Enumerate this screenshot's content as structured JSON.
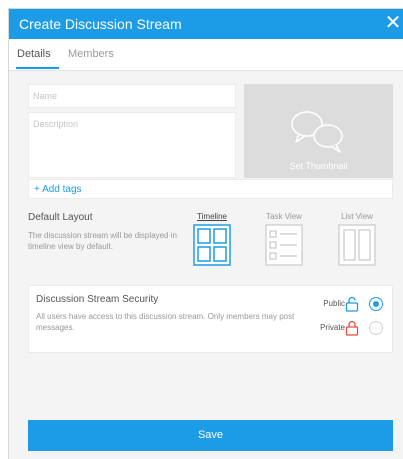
{
  "dialog": {
    "title": "Create Discussion Stream",
    "close_icon": "close-icon",
    "accent_color": "#1c9be6"
  },
  "tabs": [
    {
      "label": "Details",
      "active": true
    },
    {
      "label": "Members",
      "active": false
    }
  ],
  "form": {
    "name_placeholder": "Name",
    "description_placeholder": "Description",
    "thumbnail_label": "Set Thumbnail",
    "thumbnail_icon": "chat-bubbles-icon",
    "add_tags_label": "+ Add tags"
  },
  "layout": {
    "heading": "Default Layout",
    "description": "The discussion stream will be displayed in timeline view by default.",
    "options": [
      {
        "label": "Timeline",
        "icon": "timeline-grid-icon",
        "selected": true
      },
      {
        "label": "Task View",
        "icon": "task-list-icon",
        "selected": false
      },
      {
        "label": "List View",
        "icon": "list-columns-icon",
        "selected": false
      }
    ]
  },
  "security": {
    "heading": "Discussion Stream Security",
    "description": "All users have access to this discussion stream. Only members may post messages.",
    "options": [
      {
        "label": "Public",
        "icon": "unlocked-icon",
        "color": "#1c9be6",
        "selected": true
      },
      {
        "label": "Private",
        "icon": "locked-icon",
        "color": "#e74c3c",
        "selected": false
      }
    ]
  },
  "save_label": "Save"
}
